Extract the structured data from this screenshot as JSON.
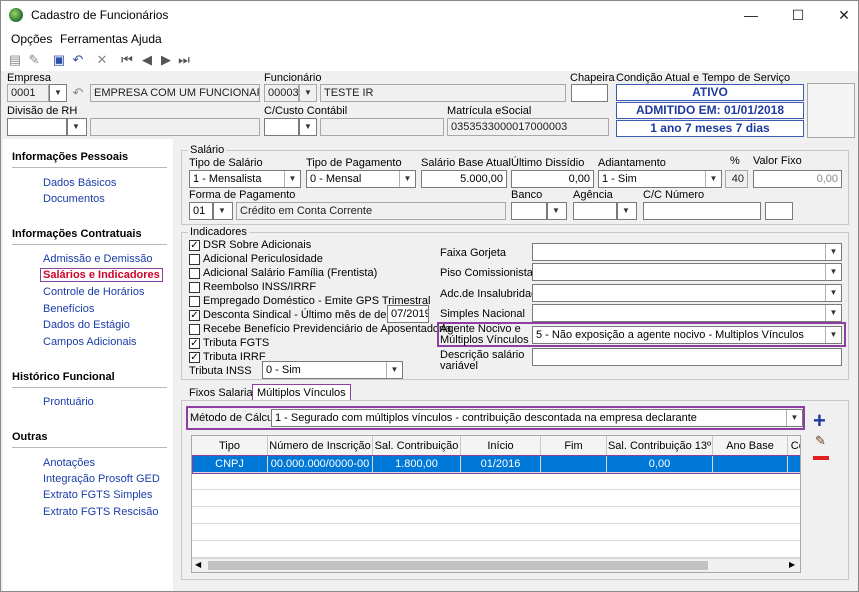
{
  "window": {
    "title": "Cadastro de Funcionários",
    "minimize": "—",
    "maximize": "☐",
    "close": "✕"
  },
  "menu": [
    "Opções",
    "Ferramentas",
    "Ajuda"
  ],
  "header": {
    "empresa_label": "Empresa",
    "empresa_code": "0001",
    "empresa_name": "EMPRESA COM UM FUNCIONARIO",
    "funcionario_label": "Funcionário",
    "funcionario_code": "00003",
    "funcionario_name": "TESTE IR",
    "chapeira_label": "Chapeira",
    "chapeira_value": "",
    "condicao_label": "Condição Atual e Tempo de Serviço",
    "status": "ATIVO",
    "admitido": "ADMITIDO EM: 01/01/2018",
    "tempo": "1 ano 7 meses 7 dias",
    "divisao_label": "Divisão de RH",
    "divisao_value": "",
    "ccusto_label": "C/Custo Contábil",
    "ccusto_value": "",
    "matricula_label": "Matrícula eSocial",
    "matricula_value": "0353533000017000003"
  },
  "sidebar": {
    "sections": [
      {
        "title": "Informações Pessoais",
        "items": [
          "Dados Básicos",
          "Documentos"
        ]
      },
      {
        "title": "Informações Contratuais",
        "items": [
          "Admissão e Demissão",
          "Salários e Indicadores",
          "Controle de Horários",
          "Benefícios",
          "Dados do Estágio",
          "Campos Adicionais"
        ]
      },
      {
        "title": "Histórico Funcional",
        "items": [
          "Prontuário"
        ]
      },
      {
        "title": "Outras",
        "items": [
          "Anotações",
          "Integração Prosoft GED",
          "Extrato FGTS Simples",
          "Extrato FGTS Rescisão"
        ]
      }
    ]
  },
  "salario": {
    "group_title": "Salário",
    "tipo_salario_label": "Tipo de Salário",
    "tipo_salario": "1 - Mensalista",
    "tipo_pagamento_label": "Tipo de Pagamento",
    "tipo_pagamento": "0 - Mensal",
    "salario_base_label": "Salário Base Atual",
    "salario_base": "5.000,00",
    "ultimo_dissidio_label": "Último Dissídio",
    "ultimo_dissidio": "0,00",
    "adiantamento_label": "Adiantamento",
    "adiantamento": "1 - Sim",
    "pct_label": "%",
    "pct": "40",
    "valor_fixo_label": "Valor Fixo",
    "valor_fixo": "0,00",
    "forma_pagamento_label": "Forma de Pagamento",
    "forma_code": "01",
    "forma_desc": "Crédito em Conta Corrente",
    "banco_label": "Banco",
    "agencia_label": "Agência",
    "cc_label": "C/C Número"
  },
  "indicadores": {
    "group_title": "Indicadores",
    "checks": [
      {
        "label": "DSR Sobre Adicionais",
        "checked": "✓"
      },
      {
        "label": "Adicional Periculosidade",
        "checked": ""
      },
      {
        "label": "Adicional Salário Família (Frentista)",
        "checked": ""
      },
      {
        "label": "Reembolso INSS/IRRF",
        "checked": ""
      },
      {
        "label": "Empregado Doméstico - Emite GPS Trimestral",
        "checked": ""
      },
      {
        "label": "Desconta Sindical - Último mês de desconto",
        "checked": "✓"
      },
      {
        "label": "Recebe Benefício Previdenciário de Aposentadoria",
        "checked": ""
      },
      {
        "label": "Tributa FGTS",
        "checked": "✓"
      },
      {
        "label": "Tributa IRRF",
        "checked": "✓"
      }
    ],
    "sindical_mes": "07/2019",
    "tributa_inss_label": "Tributa INSS",
    "tributa_inss": "0 - Sim",
    "faixa_gorjeta_label": "Faixa Gorjeta",
    "piso_label": "Piso Comissionista",
    "insalubridade_label": "Adc.de Insalubridade",
    "simples_label": "Simples Nacional",
    "agente_label_1": "Agente Nocivo e",
    "agente_label_2": "Múltiplos Vínculos",
    "agente_value": "5 - Não exposição a agente nocivo - Multiplos Vínculos",
    "descricao_label_1": "Descrição salário",
    "descricao_label_2": "variável"
  },
  "tabs": [
    "Fixos Salariais",
    "Múltiplos Vínculos"
  ],
  "multiplos": {
    "metodo_label": "Método de Cálculo",
    "metodo_value": "1 - Segurado com múltiplos vínculos - contribuição descontada na empresa declarante",
    "columns": [
      "Tipo",
      "Número de Inscrição",
      "Sal. Contribuição",
      "Início",
      "Fim",
      "Sal. Contribuição 13º",
      "Ano Base",
      "Cc"
    ],
    "rows": [
      {
        "tipo": "CNPJ",
        "inscricao": "00.000.000/0000-00",
        "sal": "1.800,00",
        "inicio": "01/2016",
        "fim": "",
        "sal13": "0,00",
        "ano": ""
      }
    ]
  },
  "icons": [
    "app-icon",
    "new-icon",
    "edit-icon",
    "save-icon",
    "undo-icon",
    "delete-icon",
    "first-icon",
    "prev-icon",
    "next-icon",
    "last-icon",
    "add-icon",
    "edit-row-icon",
    "remove-icon"
  ],
  "colors": {
    "accent": "#1f3a9e",
    "link": "#1a3ca8",
    "selected_link": "#d0002a",
    "highlight": "#8e3ea0",
    "row_selected": "#0078d7"
  }
}
